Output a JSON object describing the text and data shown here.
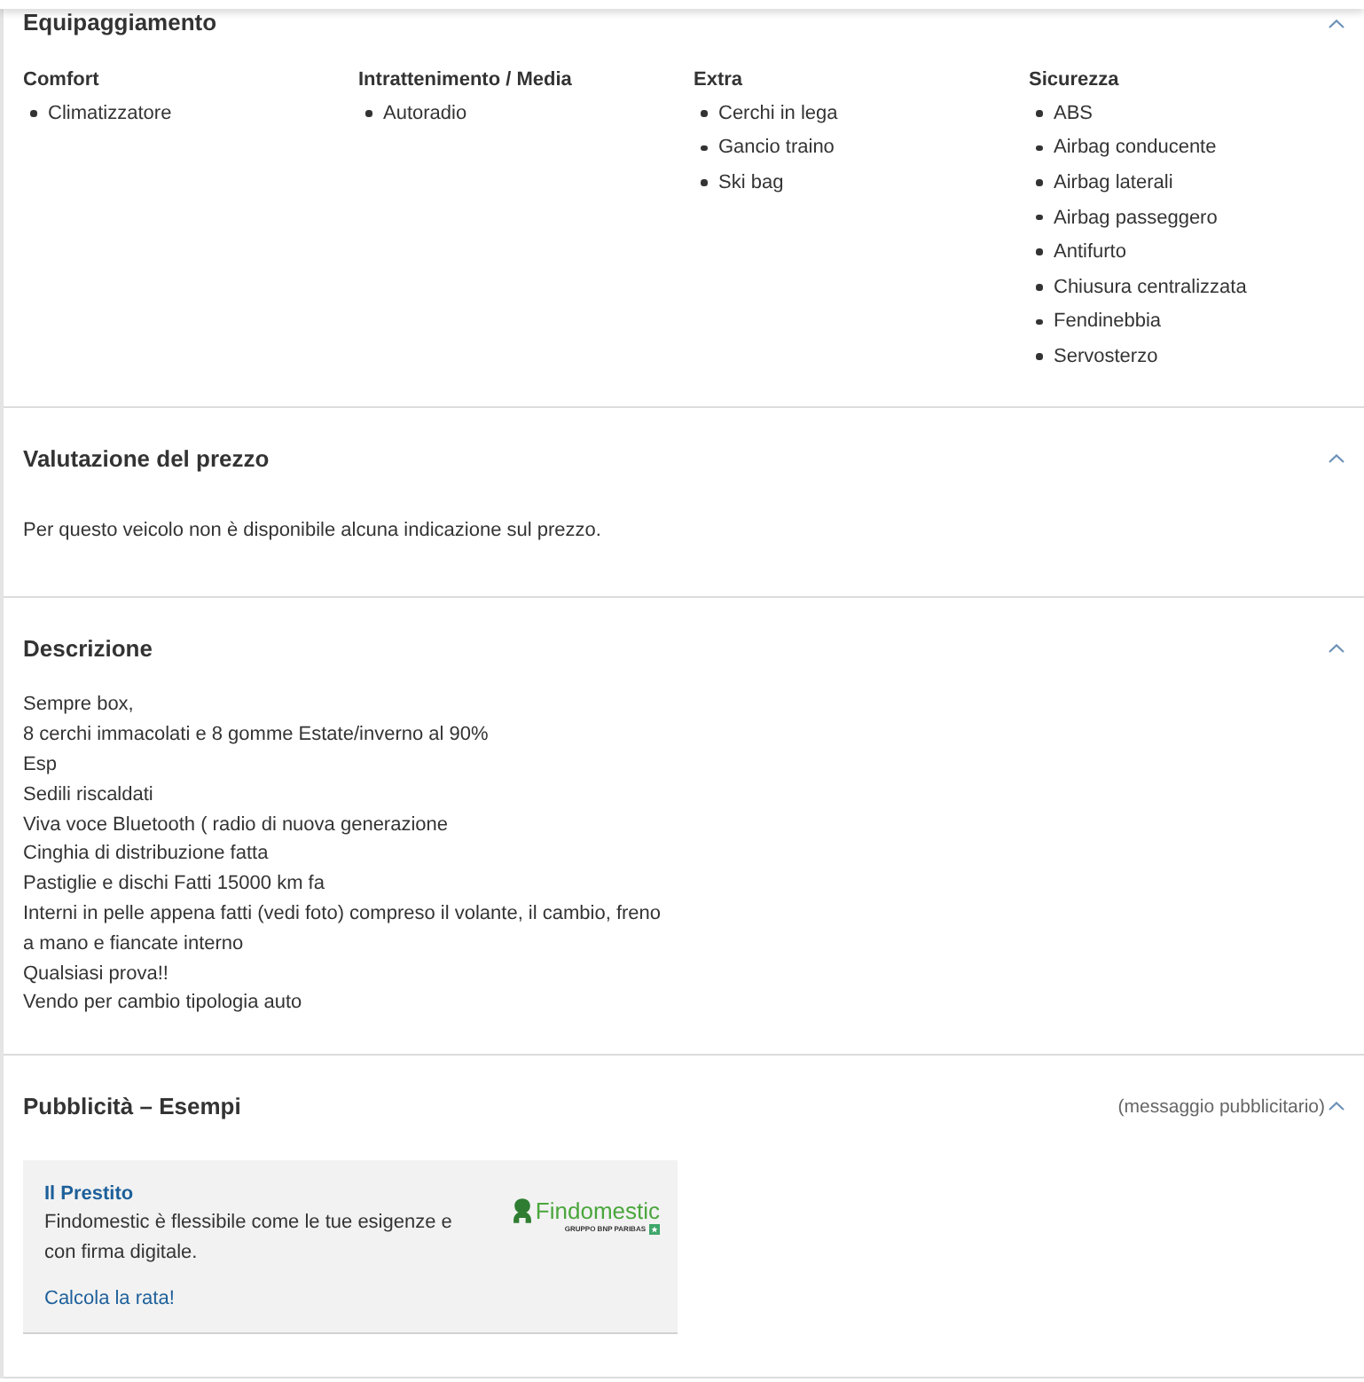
{
  "sections": [
    {
      "kind": "equipment",
      "title": "Equipaggiamento",
      "expanded": true,
      "groups": [
        {
          "title": "Comfort",
          "items": [
            "Climatizzatore"
          ]
        },
        {
          "title": "Intrattenimento / Media",
          "items": [
            "Autoradio"
          ]
        },
        {
          "title": "Extra",
          "items": [
            "Cerchi in lega",
            "Gancio traino",
            "Ski bag"
          ]
        },
        {
          "title": "Sicurezza",
          "items": [
            "ABS",
            "Airbag conducente",
            "Airbag laterali",
            "Airbag passeggero",
            "Antifurto",
            "Chiusura centralizzata",
            "Fendinebbia",
            "Servosterzo"
          ]
        }
      ]
    },
    {
      "kind": "text",
      "title": "Valutazione del prezzo",
      "expanded": true,
      "paragraph": "Per questo veicolo non è disponibile alcuna indicazione sul prezzo."
    },
    {
      "kind": "lines",
      "title": "Descrizione",
      "expanded": true,
      "lines": [
        "Sempre box,",
        "8 cerchi immacolati e 8 gomme Estate/inverno al 90%",
        "Esp",
        "Sedili riscaldati",
        "Viva voce Bluetooth ( radio di nuova generazione",
        "Cinghia di distribuzione fatta",
        "Pastiglie e dischi Fatti 15000 km fa",
        "Interni in pelle appena fatti (vedi foto) compreso il volante, il cambio, freno a mano e fiancate interno",
        "Qualsiasi prova!!",
        "Vendo per cambio tipologia auto"
      ]
    },
    {
      "kind": "ad",
      "title": "Pubblicità – Esempi",
      "expanded": true,
      "note": "(messaggio pubblicitario)",
      "ad": {
        "title": "Il Prestito",
        "text": "Findomestic è flessibile come le tue esigenze e con firma digitale.",
        "link": "Calcola la rata!",
        "logo": {
          "wordmark": "Findomestic",
          "tagline": "GRUPPO BNP PARIBAS"
        }
      }
    }
  ]
}
